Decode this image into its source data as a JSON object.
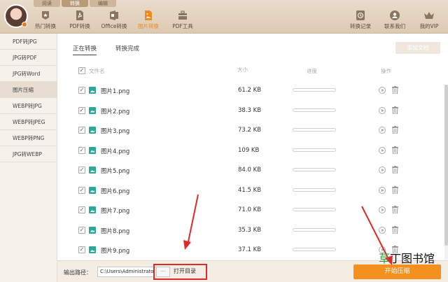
{
  "top_tabs": [
    "阅读",
    "转换",
    "编辑"
  ],
  "toolbar": {
    "left": [
      {
        "label": "热门转换",
        "icon": "hot-icon"
      },
      {
        "label": "PDF转换",
        "icon": "pdf-icon"
      },
      {
        "label": "Office转换",
        "icon": "office-icon"
      },
      {
        "label": "图片转换",
        "icon": "image-convert-icon"
      },
      {
        "label": "PDF工具",
        "icon": "toolbox-icon"
      }
    ],
    "right": [
      {
        "label": "转换记录",
        "icon": "history-icon"
      },
      {
        "label": "联系我们",
        "icon": "contact-icon"
      },
      {
        "label": "我的VIP",
        "icon": "crown-icon"
      }
    ]
  },
  "sidebar": {
    "items": [
      {
        "label": "PDF转JPG"
      },
      {
        "label": "JPG转PDF"
      },
      {
        "label": "JPG转Word"
      },
      {
        "label": "图片压缩"
      },
      {
        "label": "WEBP转JPG"
      },
      {
        "label": "WEBP转JPEG"
      },
      {
        "label": "WEBP转PNG"
      },
      {
        "label": "JPG转WEBP"
      }
    ]
  },
  "tabs": {
    "converting": "正在转换",
    "done": "转换完成"
  },
  "add_button": "添加文档",
  "columns": {
    "name": "文件名",
    "size": "大小",
    "progress": "进度",
    "action": "操作"
  },
  "files": [
    {
      "name": "图片1.png",
      "size": "61.2 KB",
      "progress": 0
    },
    {
      "name": "图片2.png",
      "size": "38.3 KB",
      "progress": 0
    },
    {
      "name": "图片3.png",
      "size": "73.2 KB",
      "progress": 0
    },
    {
      "name": "图片4.png",
      "size": "109 KB",
      "progress": 0
    },
    {
      "name": "图片5.png",
      "size": "84.0 KB",
      "progress": 0
    },
    {
      "name": "图片6.png",
      "size": "41.5 KB",
      "progress": 0
    },
    {
      "name": "图片7.png",
      "size": "71.0 KB",
      "progress": 0
    },
    {
      "name": "图片8.png",
      "size": "35.3 KB",
      "progress": 0
    },
    {
      "name": "图片9.png",
      "size": "37.1 KB",
      "progress": 0
    }
  ],
  "bottom": {
    "output_label": "输出路径：",
    "path": "C:\\Users\\Administrator",
    "browse": "···",
    "open_dir": "打开目录",
    "start": "开始压缩"
  },
  "watermark": {
    "part1": "草",
    "part2": "丁图书馆"
  },
  "colors": {
    "accent": "#f5901f",
    "highlight": "#e02a2a"
  }
}
